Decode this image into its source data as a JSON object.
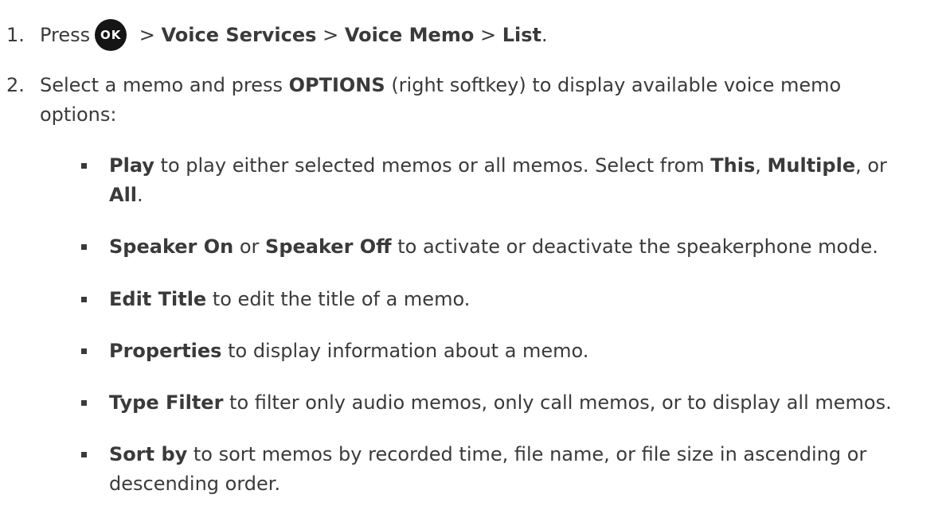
{
  "steps": [
    {
      "number": "1.",
      "parts": {
        "press": "Press",
        "ok_icon_label": "OK",
        "sep1": " > ",
        "voice_services": "Voice Services",
        "sep2": " > ",
        "voice_memo": "Voice Memo",
        "sep3": " > ",
        "list": "List",
        "end": "."
      }
    },
    {
      "number": "2.",
      "parts": {
        "select": "Select a memo and press ",
        "options": "OPTIONS",
        "line1_rest": " (right softkey) to display available voice memo",
        "line2": "options:"
      }
    }
  ],
  "bullets": [
    {
      "term1": "Play",
      "line1_text": " to play either selected memos or all memos. Select from ",
      "term2": "This",
      "sep1": ", ",
      "term3": "Multiple",
      "sep2": ", or",
      "term4": "All",
      "end": "."
    },
    {
      "term1": "Speaker On",
      "mid": " or ",
      "term2": "Speaker Off",
      "text": " to activate or deactivate the speakerphone mode."
    },
    {
      "term": "Edit Title",
      "text": " to edit the title of a memo."
    },
    {
      "term": "Properties",
      "text": " to display information about a memo."
    },
    {
      "term": "Type Filter",
      "text": " to filter only audio memos, only call memos, or to display all memos."
    },
    {
      "term": "Sort by",
      "line1_text": " to sort memos by recorded time, file name, or file size in ascending or",
      "line2_text": "descending order."
    }
  ],
  "icons": {
    "ok_icon": "ok-button-icon",
    "bullet_icon": "square-bullet-icon"
  },
  "colors": {
    "text": "#3a3a3a",
    "ok_icon_bg": "#151515",
    "ok_icon_fg": "#ffffff"
  }
}
